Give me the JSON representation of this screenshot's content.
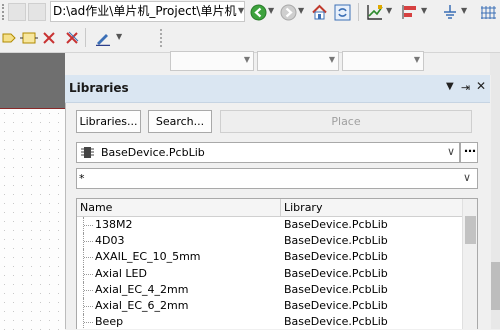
{
  "toolbar": {
    "path": "D:\\ad作业\\单片机_Project\\单片机"
  },
  "panel": {
    "title": "Libraries",
    "libraries_button": "Libraries...",
    "search_button": "Search...",
    "place_button": "Place",
    "selected_library": "BaseDevice.PcbLib",
    "filter_value": "*",
    "columns": {
      "name": "Name",
      "library": "Library"
    },
    "rows": [
      {
        "name": "138M2",
        "library": "BaseDevice.PcbLib"
      },
      {
        "name": "4D03",
        "library": "BaseDevice.PcbLib"
      },
      {
        "name": "AXAIL_EC_10_5mm",
        "library": "BaseDevice.PcbLib"
      },
      {
        "name": "Axial LED",
        "library": "BaseDevice.PcbLib"
      },
      {
        "name": "Axial_EC_4_2mm",
        "library": "BaseDevice.PcbLib"
      },
      {
        "name": "Axial_EC_6_2mm",
        "library": "BaseDevice.PcbLib"
      },
      {
        "name": "Beep",
        "library": "BaseDevice.PcbLib"
      }
    ]
  },
  "colors": {
    "panel_title_bg": "#dae6f2",
    "doc_border": "#8a2a2a"
  }
}
